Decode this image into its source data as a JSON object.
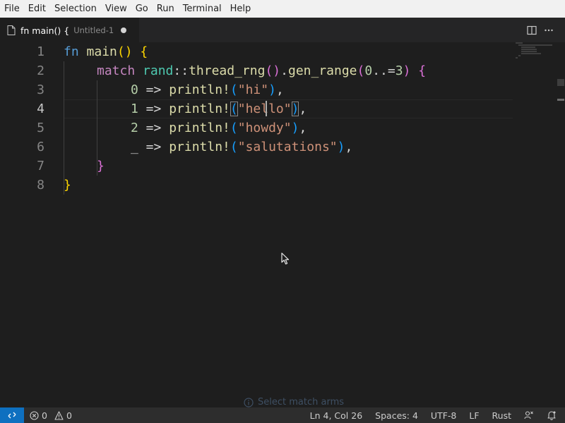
{
  "menubar": {
    "items": [
      "File",
      "Edit",
      "Selection",
      "View",
      "Go",
      "Run",
      "Terminal",
      "Help"
    ]
  },
  "tab": {
    "title": "fn main() {",
    "description": "Untitled-1",
    "icon": "file-icon",
    "dirty": true
  },
  "tab_actions": [
    "split-editor-icon",
    "more-actions-icon"
  ],
  "editor": {
    "line_numbers": [
      "1",
      "2",
      "3",
      "4",
      "5",
      "6",
      "7",
      "8"
    ],
    "active_line": 4,
    "code": {
      "l1": {
        "kw": "fn",
        "name": " main",
        "paren": "()",
        "brace": "{"
      },
      "l2": {
        "kw": "match",
        "ns": "rand",
        "sep": "::",
        "f1": "thread_rng",
        "p1": "()",
        "dot": ".",
        "f2": "gen_range",
        "open": "(",
        "n0": "0",
        "range": "..=",
        "n3": "3",
        "close": ")",
        "brace": "{"
      },
      "arms": [
        {
          "pat": "0",
          "arrow": " => ",
          "macro": "println!",
          "open": "(",
          "str": "\"hi\"",
          "close": ")",
          "comma": ","
        },
        {
          "pat": "1",
          "arrow": " => ",
          "macro": "println!",
          "open": "(",
          "str": "\"hello\"",
          "close": ")",
          "comma": ","
        },
        {
          "pat": "2",
          "arrow": " => ",
          "macro": "println!",
          "open": "(",
          "str": "\"howdy\"",
          "close": ")",
          "comma": ","
        },
        {
          "pat": "_",
          "arrow": " => ",
          "macro": "println!",
          "open": "(",
          "str": "\"salutations\"",
          "close": ")",
          "comma": ","
        }
      ],
      "l7": {
        "brace": "}"
      },
      "l8": {
        "brace": "}"
      }
    }
  },
  "hint": {
    "icon": "info-icon",
    "text": "Select match arms"
  },
  "statusbar": {
    "remote_icon": "remote-icon",
    "errors": "0",
    "warnings": "0",
    "position": "Ln 4, Col 26",
    "indent": "Spaces: 4",
    "encoding": "UTF-8",
    "eol": "LF",
    "language": "Rust",
    "feedback_icon": "feedback-icon",
    "bell_icon": "bell-icon"
  },
  "colors": {
    "accent": "#0e70c0",
    "keyword": "#569cd6",
    "control": "#c586c0",
    "function": "#dcdcaa",
    "string": "#ce9178",
    "number": "#b5cea8"
  }
}
